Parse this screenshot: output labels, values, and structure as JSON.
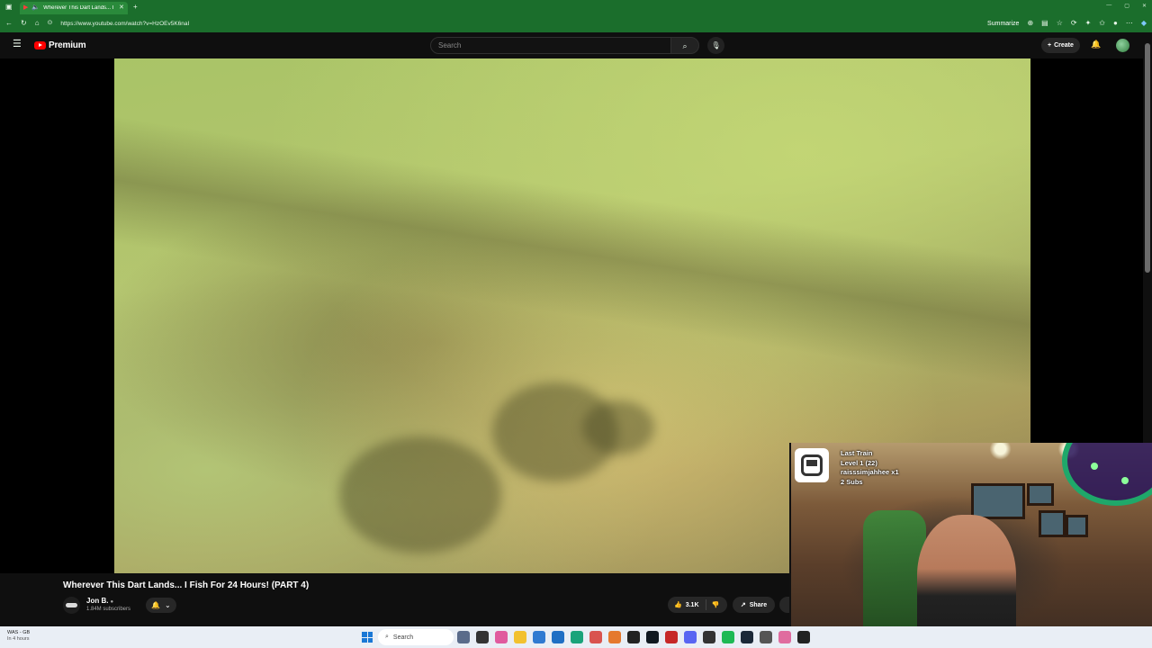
{
  "browser": {
    "tab_title": "Wherever This Dart Lands... I",
    "url": "https://www.youtube.com/watch?v=HzOEv5K6naI",
    "summarize_label": "Summarize"
  },
  "masthead": {
    "logo_text": "Premium",
    "search_placeholder": "Search",
    "create_label": "Create"
  },
  "video": {
    "title": "Wherever This Dart Lands... I Fish For 24 Hours! (PART 4)",
    "channel_name": "Jon B.",
    "subscribers": "1.84M subscribers",
    "likes": "3.1K",
    "share_label": "Share"
  },
  "overlay": {
    "alert_lines": [
      "Last Train",
      "Level 1  (22)",
      "raisssimjahhee x1",
      "2 Subs"
    ]
  },
  "taskbar": {
    "weather_title": "WAS - GB",
    "weather_sub": "In 4 hours",
    "search_placeholder": "Search"
  },
  "colors": {
    "browser_accent": "#1b6e2c",
    "youtube_red": "#ff0000",
    "page_bg": "#0f0f0f"
  }
}
